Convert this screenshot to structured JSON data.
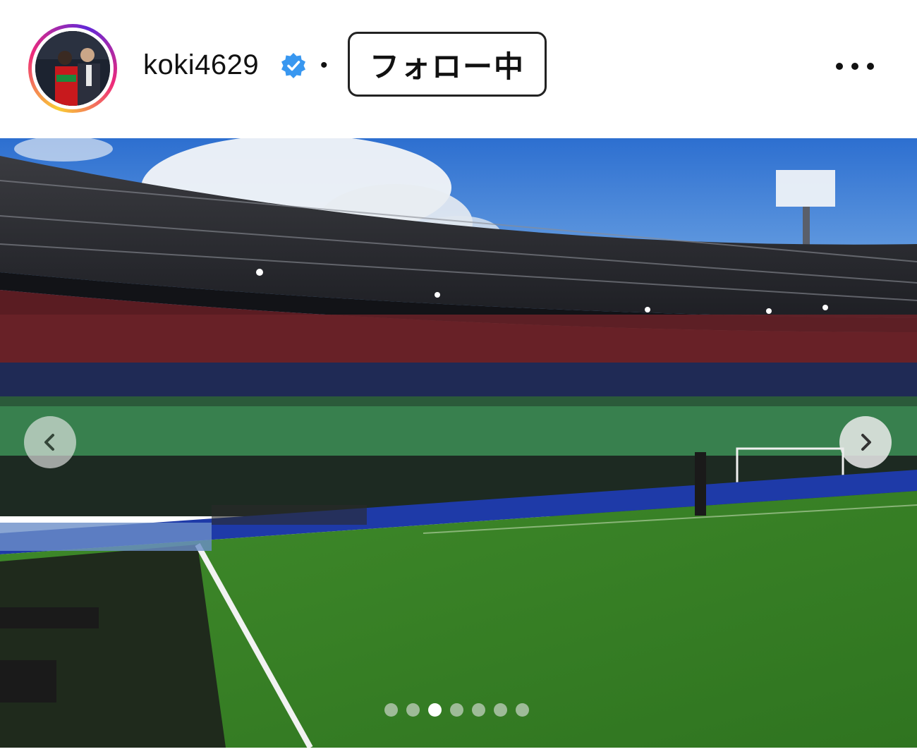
{
  "post_header": {
    "username": "koki4629",
    "verified": true,
    "separator": "•",
    "follow_button_label": "フォロー中",
    "more_icon": "more-horizontal-icon"
  },
  "photo": {
    "description_icon": "stadium-photo",
    "carousel": {
      "total_slides": 7,
      "active_index": 3,
      "prev_icon": "chevron-left-icon",
      "next_icon": "chevron-right-icon"
    }
  },
  "colors": {
    "story_ring_start": "#f9ce34",
    "story_ring_mid": "#ee2a7b",
    "verified_blue": "#3897f0",
    "follow_border": "#222222"
  }
}
